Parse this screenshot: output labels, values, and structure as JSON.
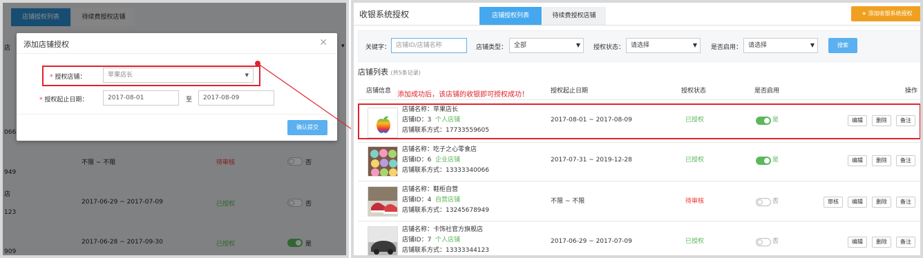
{
  "left": {
    "tabs": [
      "店铺授权列表",
      "待续费授权店铺"
    ],
    "bg_rows": [
      {
        "date": "不限 ~ 不限",
        "status": "待审核",
        "enabled": "否"
      },
      {
        "date": "2017-06-29 ~ 2017-07-09",
        "status": "已授权",
        "enabled": "否"
      },
      {
        "date": "2017-06-28 ~ 2017-09-30",
        "status": "已授权",
        "enabled": "是"
      }
    ],
    "bg_edge": [
      "店",
      "066",
      "949",
      "店",
      "123",
      "909"
    ],
    "modal": {
      "title": "添加店铺授权",
      "store_label": "授权店铺：",
      "store_value": "苹果店长",
      "date_label": "授权起止日期：",
      "start_date": "2017-08-01",
      "to": "至",
      "end_date": "2017-08-09",
      "confirm": "确认提交"
    }
  },
  "right": {
    "title": "收银系统授权",
    "tabs": [
      "店铺授权列表",
      "待续费授权店铺"
    ],
    "add_button": "添加收银系统授权",
    "filters": {
      "keyword_label": "关键字：",
      "keyword_placeholder": "店铺ID/店铺名称",
      "type_label": "店铺类型：",
      "type_value": "全部",
      "status_label": "授权状态：",
      "status_value": "请选择",
      "enabled_label": "是否启用：",
      "enabled_value": "请选择",
      "search": "搜索"
    },
    "list_title": "店铺列表",
    "list_count": "(共5条记录)",
    "columns": [
      "店铺信息",
      "授权起止日期",
      "授权状态",
      "是否启用",
      "操作"
    ],
    "annotation": "添加成功后，该店铺的收银即可授权成功！",
    "rows": [
      {
        "name": "店铺名称：苹果店长",
        "id": "店铺ID：3",
        "type": "个人店铺",
        "contact": "店铺联系方式：17733559605",
        "date": "2017-08-01 ~ 2017-08-09",
        "status": "已授权",
        "enabled": "是",
        "actions": [
          "编辑",
          "删除",
          "备注"
        ]
      },
      {
        "name": "店铺名称：吃子之心零食店",
        "id": "店铺ID：6",
        "type": "企业店铺",
        "contact": "店铺联系方式：13333340066",
        "date": "2017-07-31 ~ 2019-12-28",
        "status": "已授权",
        "enabled": "是",
        "actions": [
          "编辑",
          "删除",
          "备注"
        ]
      },
      {
        "name": "店铺名称：鞋柜自营",
        "id": "店铺ID：4",
        "type": "自营店铺",
        "contact": "店铺联系方式：13245678949",
        "date": "不限 ~ 不限",
        "status": "待审核",
        "enabled": "否",
        "actions": [
          "审核",
          "编辑",
          "删除",
          "备注"
        ]
      },
      {
        "name": "店铺名称：卡饰社官方旗舰店",
        "id": "店铺ID：7",
        "type": "个人店铺",
        "contact": "店铺联系方式：13333344123",
        "date": "2017-06-29 ~ 2017-07-09",
        "status": "已授权",
        "enabled": "否",
        "actions": [
          "编辑",
          "删除",
          "备注"
        ]
      }
    ]
  },
  "colors": {
    "accent": "#5ab0f0",
    "orange": "#f0a020",
    "green": "#5cb85c",
    "red": "#e0222b"
  }
}
